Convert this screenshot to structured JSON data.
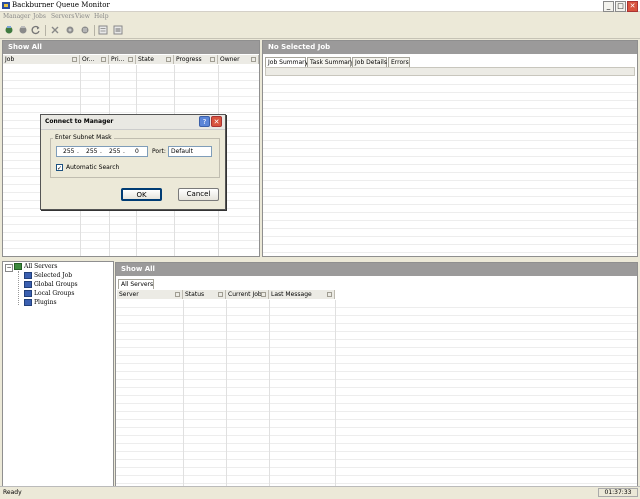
{
  "window": {
    "title": "Backburner Queue Monitor",
    "controls": {
      "minimize": "_",
      "maximize": "□",
      "close": "✕"
    }
  },
  "menu": [
    "Manager",
    "Jobs",
    "Servers",
    "View",
    "Help"
  ],
  "toolbar": {
    "icons": [
      "connect-icon",
      "disconnect-icon",
      "refresh-icon",
      "delete-icon",
      "activate-icon",
      "suspend-icon",
      "assign-icon",
      "properties-icon"
    ]
  },
  "jobs_panel": {
    "title": "Show All",
    "columns": [
      "Job",
      "Or...",
      "Pri...",
      "State",
      "Progress",
      "Owner"
    ]
  },
  "job_detail_panel": {
    "title": "No Selected Job",
    "tabs": [
      "Job Summary",
      "Task Summary",
      "Job Details",
      "Errors"
    ]
  },
  "tree": {
    "root": "All Servers",
    "children": [
      "Selected Job",
      "Global Groups",
      "Local Groups",
      "Plugins"
    ],
    "expander": "−"
  },
  "servers_panel": {
    "title": "Show All",
    "tabs": [
      "All Servers"
    ],
    "columns": [
      "Server",
      "Status",
      "Current Job",
      "Last Message"
    ]
  },
  "status": {
    "left": "Ready",
    "time": "01:37:33"
  },
  "dialog": {
    "title": "Connect to Manager",
    "help_label": "?",
    "close_label": "✕",
    "group_label": "Enter Subnet Mask",
    "subnet": [
      "255",
      "255",
      "255",
      "0"
    ],
    "dot": ".",
    "port_label": "Port:",
    "port_value": "Default",
    "auto_search_label": "Automatic Search",
    "auto_search_checked": true,
    "check_mark": "✓",
    "ok_label": "OK",
    "cancel_label": "Cancel"
  },
  "colors": {
    "panel_title_bg": "#9b9a9a",
    "close_button": "#d8543e",
    "dialog_border_blue": "#003c74"
  }
}
